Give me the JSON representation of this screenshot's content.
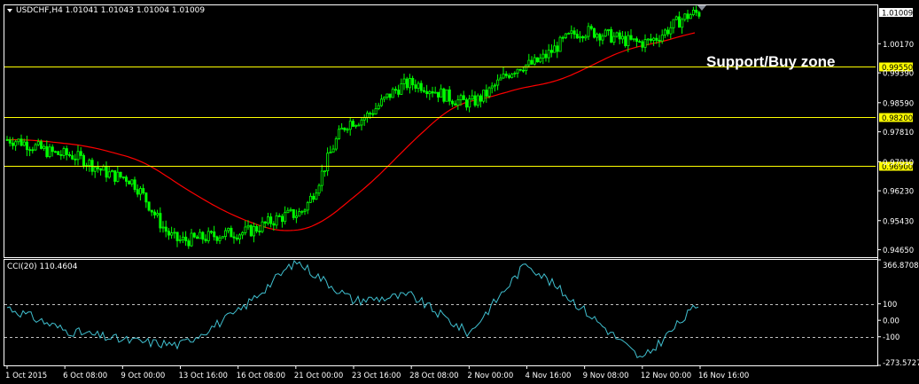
{
  "main_pane": {
    "header": "USDCHF,H4  1.01041 1.01043 1.01004 1.01009",
    "annotation": "Support/Buy zone",
    "price_labels": [
      "1.01009",
      "1.00170",
      "0.99550",
      "0.99390",
      "0.98590",
      "0.98200",
      "0.97810",
      "0.97010",
      "0.96900",
      "0.96230",
      "0.95430",
      "0.94650"
    ],
    "marked_levels": [
      "0.99550",
      "0.98200",
      "0.96900"
    ],
    "current_price": "1.01009"
  },
  "indicator_pane": {
    "header": "CCI(20) 110.4604",
    "labels": [
      "366.8708",
      "100",
      "0.00",
      "-100",
      "-273.5727"
    ]
  },
  "time_axis": {
    "labels": [
      "1 Oct 2015",
      "6 Oct 08:00",
      "9 Oct 00:00",
      "13 Oct 16:00",
      "16 Oct 08:00",
      "21 Oct 00:00",
      "23 Oct 16:00",
      "28 Oct 08:00",
      "2 Nov 00:00",
      "4 Nov 16:00",
      "9 Nov 08:00",
      "12 Nov 00:00",
      "16 Nov 16:00"
    ]
  },
  "colors": {
    "background": "#000000",
    "candles": "#00ff00",
    "support_lines": "#ffff00",
    "moving_average": "#ff0000",
    "cci_line": "#40c0d0",
    "grid_text": "#ffffff",
    "level_badge": "#ffff00"
  },
  "chart_data": [
    {
      "type": "line",
      "title": "USDCHF,H4",
      "series": [
        {
          "name": "USDCHF",
          "x": [
            "1 Oct 2015",
            "6 Oct 08:00",
            "9 Oct 00:00",
            "13 Oct 16:00",
            "16 Oct 08:00",
            "21 Oct 00:00",
            "23 Oct 16:00",
            "28 Oct 08:00",
            "2 Nov 00:00",
            "4 Nov 16:00",
            "9 Nov 08:00",
            "12 Nov 00:00",
            "16 Nov 16:00"
          ],
          "values": [
            0.976,
            0.972,
            0.966,
            0.949,
            0.951,
            0.956,
            0.981,
            0.991,
            0.986,
            0.996,
            1.005,
            1.002,
            1.01
          ]
        }
      ],
      "horizontal_lines": [
        0.9955,
        0.982,
        0.969
      ],
      "ylim": [
        0.9445,
        1.012
      ]
    },
    {
      "type": "line",
      "title": "CCI(20) 110.4604",
      "series": [
        {
          "name": "CCI(20)",
          "x": [
            "1 Oct 2015",
            "6 Oct 08:00",
            "9 Oct 00:00",
            "13 Oct 16:00",
            "16 Oct 08:00",
            "21 Oct 00:00",
            "23 Oct 16:00",
            "28 Oct 08:00",
            "2 Nov 00:00",
            "4 Nov 16:00",
            "9 Nov 08:00",
            "12 Nov 00:00",
            "16 Nov 16:00"
          ],
          "values": [
            80,
            -60,
            -120,
            -150,
            50,
            360,
            120,
            150,
            -80,
            350,
            60,
            -240,
            110
          ]
        }
      ],
      "horizontal_lines": [
        100,
        -100
      ],
      "ylim": [
        -273.5727,
        366.8708
      ]
    }
  ]
}
